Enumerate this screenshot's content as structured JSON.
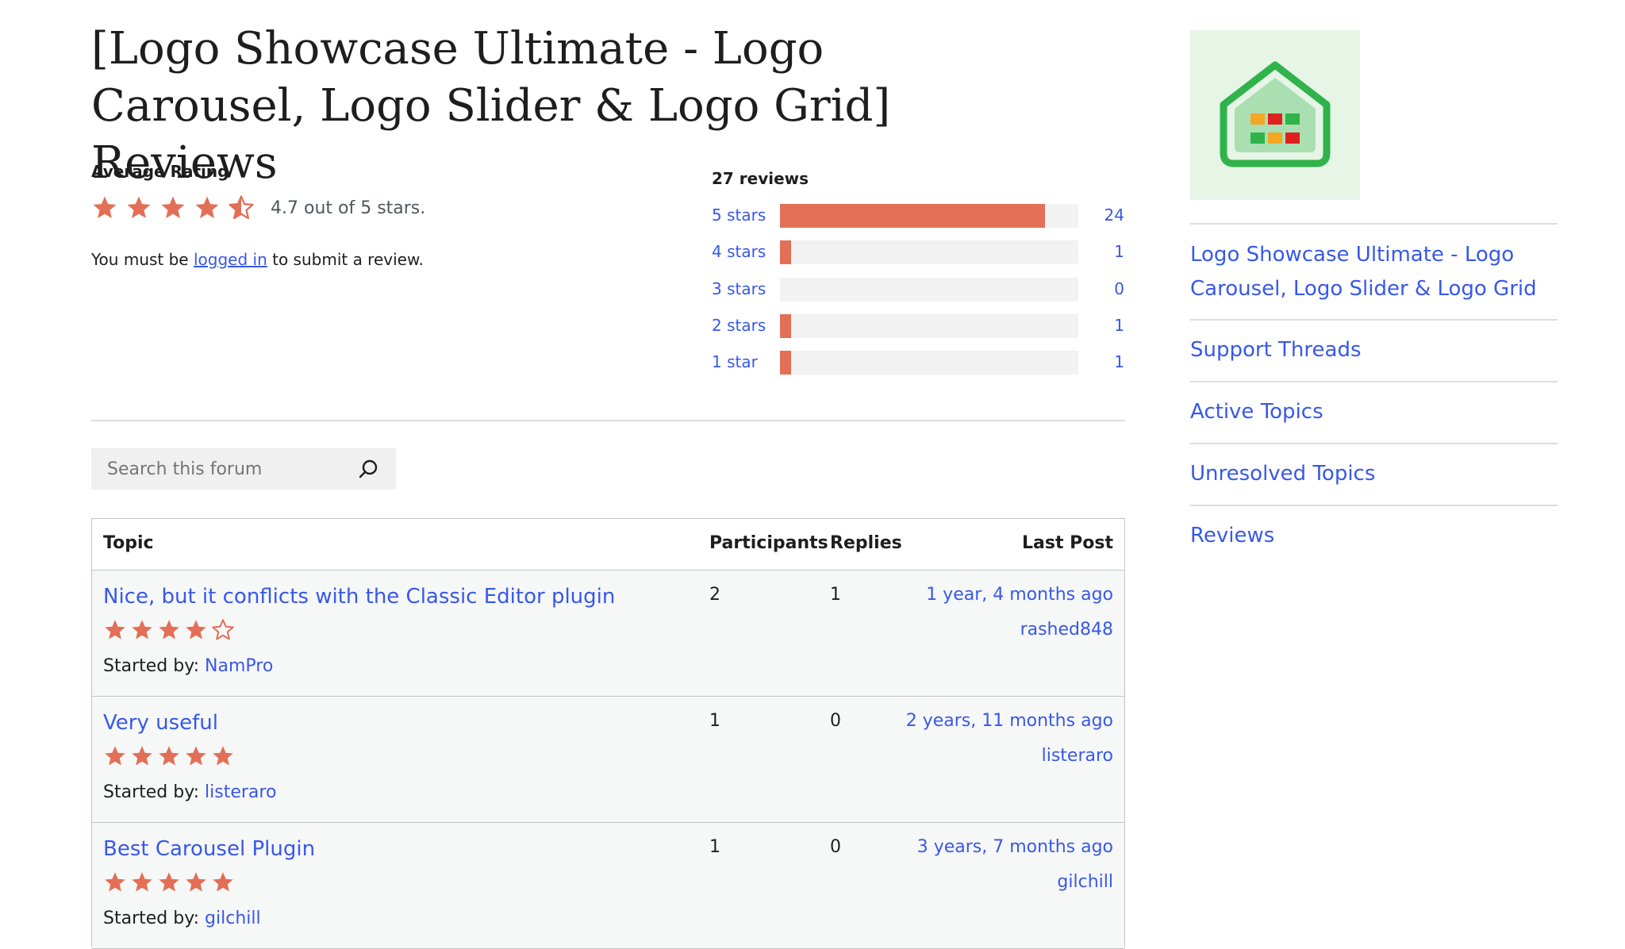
{
  "page_title": "[Logo Showcase Ultimate - Logo Carousel, Logo Slider & Logo Grid] Reviews",
  "average": {
    "label": "Average Rating",
    "stars": 4.7,
    "text": "4.7 out of 5 stars."
  },
  "login_note": {
    "prefix": "You must be ",
    "link": "logged in",
    "suffix": " to submit a review."
  },
  "breakdown": {
    "total": "27 reviews",
    "rows": [
      {
        "label": "5 stars",
        "count": "24",
        "fraction": 0.889
      },
      {
        "label": "4 stars",
        "count": "1",
        "fraction": 0.037
      },
      {
        "label": "3 stars",
        "count": "0",
        "fraction": 0
      },
      {
        "label": "2 stars",
        "count": "1",
        "fraction": 0.037
      },
      {
        "label": "1 star",
        "count": "1",
        "fraction": 0.037
      }
    ]
  },
  "search": {
    "placeholder": "Search this forum"
  },
  "table": {
    "headers": {
      "topic": "Topic",
      "participants": "Participants",
      "replies": "Replies",
      "last_post": "Last Post"
    },
    "started_by_label": "Started by: ",
    "rows": [
      {
        "title": "Nice, but it conflicts with the Classic Editor plugin",
        "rating": 4,
        "author": "NamPro",
        "participants": "2",
        "replies": "1",
        "last_post": "1 year, 4 months ago",
        "last_author": "rashed848"
      },
      {
        "title": "Very useful",
        "rating": 5,
        "author": "listeraro",
        "participants": "1",
        "replies": "0",
        "last_post": "2 years, 11 months ago",
        "last_author": "listeraro"
      },
      {
        "title": "Best Carousel Plugin",
        "rating": 5,
        "author": "gilchill",
        "participants": "1",
        "replies": "0",
        "last_post": "3 years, 7 months ago",
        "last_author": "gilchill"
      }
    ]
  },
  "sidebar": {
    "plugin_link": "Logo Showcase Ultimate - Logo Carousel, Logo Slider & Logo Grid",
    "links": [
      "Support Threads",
      "Active Topics",
      "Unresolved Topics",
      "Reviews"
    ]
  },
  "colors": {
    "accent": "#3858e9",
    "star": "#e26f56",
    "bar_track": "#f2f2f2"
  }
}
